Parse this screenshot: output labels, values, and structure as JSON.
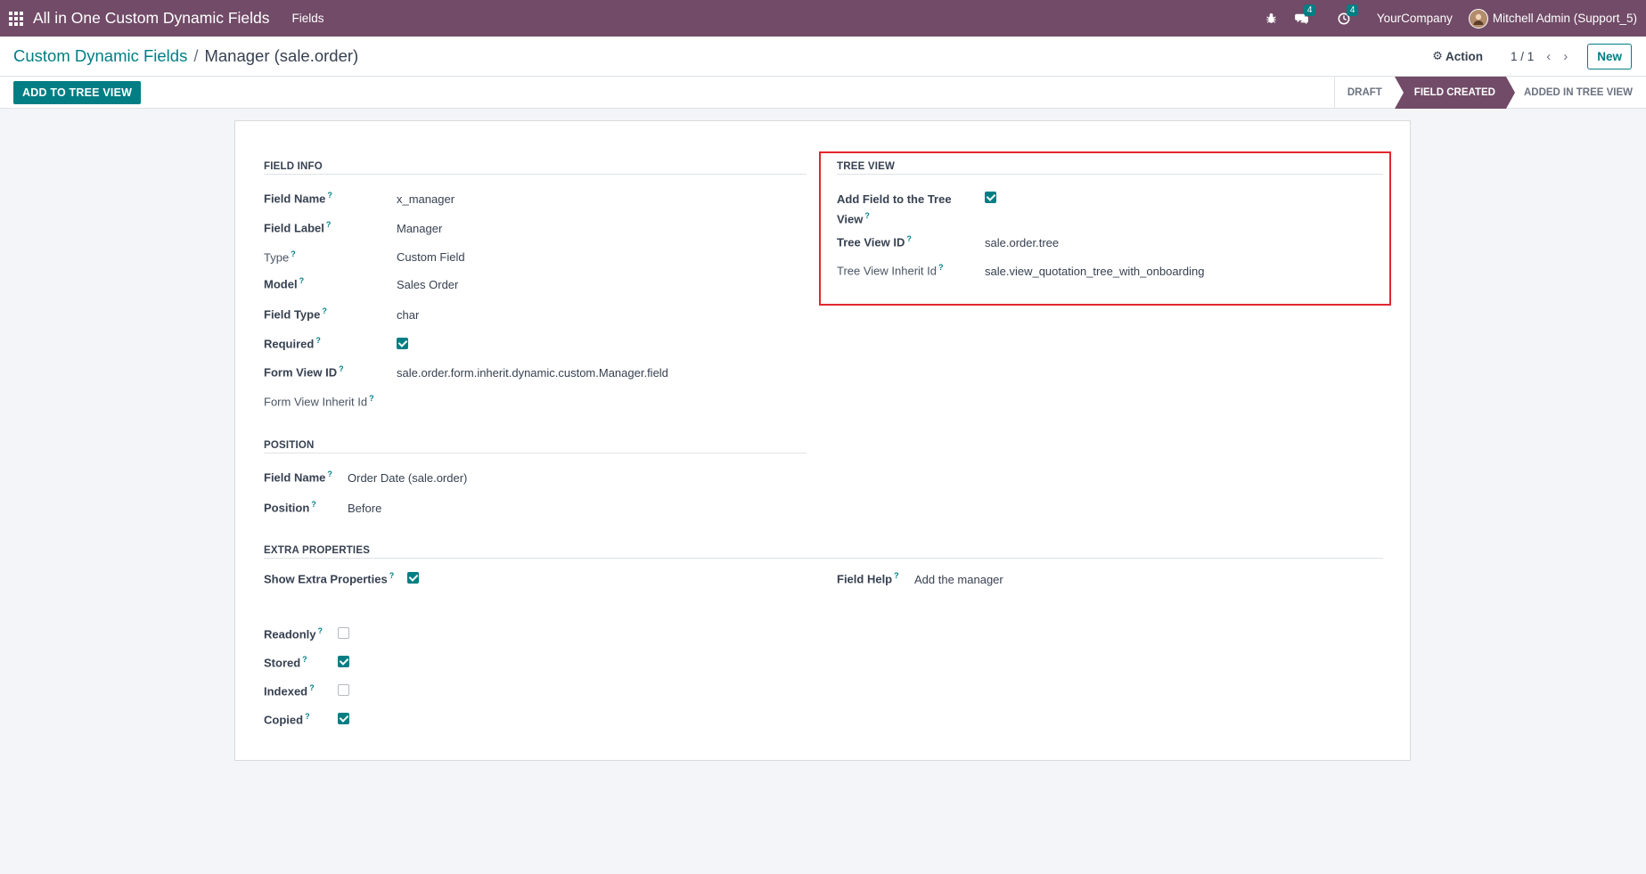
{
  "navbar": {
    "app_title": "All in One Custom Dynamic Fields",
    "menu_fields": "Fields",
    "messages_count": "4",
    "activities_count": "4",
    "company": "YourCompany",
    "user": "Mitchell Admin (Support_5)"
  },
  "control_panel": {
    "breadcrumb_parent": "Custom Dynamic Fields",
    "breadcrumb_separator": "/",
    "breadcrumb_current": "Manager (sale.order)",
    "action_label": "Action",
    "pager": "1 / 1",
    "new_label": "New"
  },
  "statusbar": {
    "add_tree_button": "ADD TO TREE VIEW",
    "stages": [
      "DRAFT",
      "FIELD CREATED",
      "ADDED IN TREE VIEW"
    ],
    "active_stage": "FIELD CREATED"
  },
  "form": {
    "field_info": {
      "title": "FIELD INFO",
      "field_name_label": "Field Name",
      "field_name_value": "x_manager",
      "field_label_label": "Field Label",
      "field_label_value": "Manager",
      "type_label": "Type",
      "type_value": "Custom Field",
      "model_label": "Model",
      "model_value": "Sales Order",
      "field_type_label": "Field Type",
      "field_type_value": "char",
      "required_label": "Required",
      "required_checked": true,
      "form_view_id_label": "Form View ID",
      "form_view_id_value": "sale.order.form.inherit.dynamic.custom.Manager.field",
      "form_view_inherit_label": "Form View Inherit Id",
      "form_view_inherit_value": ""
    },
    "tree_view": {
      "title": "TREE VIEW",
      "add_field_label_line1": "Add Field to the Tree",
      "add_field_label_line2": "View",
      "add_field_checked": true,
      "tree_view_id_label": "Tree View ID",
      "tree_view_id_value": "sale.order.tree",
      "tree_view_inherit_label": "Tree View Inherit Id",
      "tree_view_inherit_value": "sale.view_quotation_tree_with_onboarding"
    },
    "position": {
      "title": "POSITION",
      "field_name_label": "Field Name",
      "field_name_value": "Order Date (sale.order)",
      "position_label": "Position",
      "position_value": "Before"
    },
    "extra_properties": {
      "title": "EXTRA PROPERTIES",
      "show_extra_label": "Show Extra Properties",
      "show_extra_checked": true,
      "field_help_label": "Field Help",
      "field_help_value": "Add the manager",
      "readonly_label": "Readonly",
      "readonly_checked": false,
      "stored_label": "Stored",
      "stored_checked": true,
      "indexed_label": "Indexed",
      "indexed_checked": false,
      "copied_label": "Copied",
      "copied_checked": true
    },
    "help_marker": "?"
  },
  "colors": {
    "navbar": "#714b67",
    "accent": "#017e84",
    "highlight": "#e3262e"
  }
}
